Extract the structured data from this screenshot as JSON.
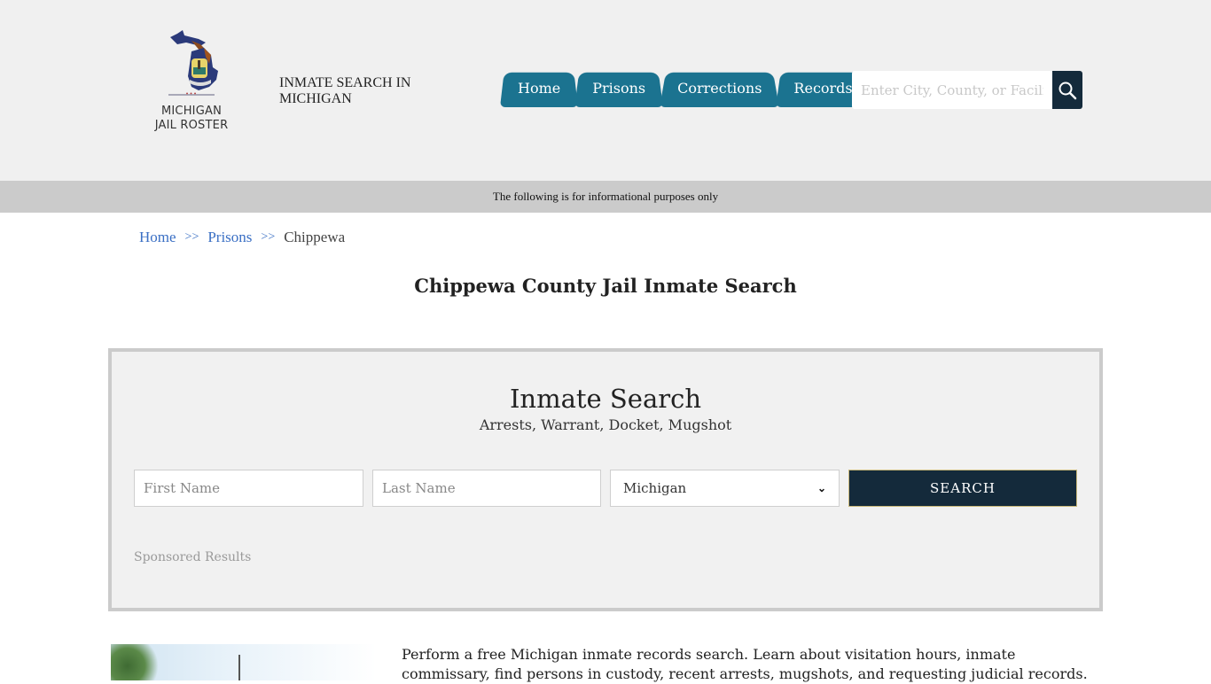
{
  "header": {
    "logo_text_line1": "MICHIGAN",
    "logo_text_line2": "JAIL ROSTER",
    "tagline": "INMATE SEARCH IN MICHIGAN",
    "nav": [
      {
        "label": "Home"
      },
      {
        "label": "Prisons"
      },
      {
        "label": "Corrections"
      },
      {
        "label": "Records"
      }
    ],
    "search": {
      "placeholder": "Enter City, County, or Facility",
      "value": "",
      "icon": "search-icon"
    },
    "colors": {
      "nav_bg": "#1b7390",
      "search_btn_bg": "#142a3b",
      "header_bg": "#f0f0f0"
    }
  },
  "info_bar": {
    "text": "The following is for informational purposes only"
  },
  "breadcrumb": {
    "items": [
      {
        "label": "Home"
      },
      {
        "label": "Prisons"
      },
      {
        "label": "Chippewa"
      }
    ],
    "separator": ">>"
  },
  "page_title": "Chippewa County Jail Inmate Search",
  "search_panel": {
    "title": "Inmate Search",
    "subtitle": "Arrests, Warrant, Docket, Mugshot",
    "first_name_placeholder": "First Name",
    "last_name_placeholder": "Last Name",
    "state_selected": "Michigan",
    "submit_label": "SEARCH",
    "sponsored_label": "Sponsored Results"
  },
  "intro": {
    "text": "Perform a free Michigan inmate records search. Learn about visitation hours, inmate commissary, find persons in custody, recent arrests, mugshots, and requesting judicial records."
  }
}
